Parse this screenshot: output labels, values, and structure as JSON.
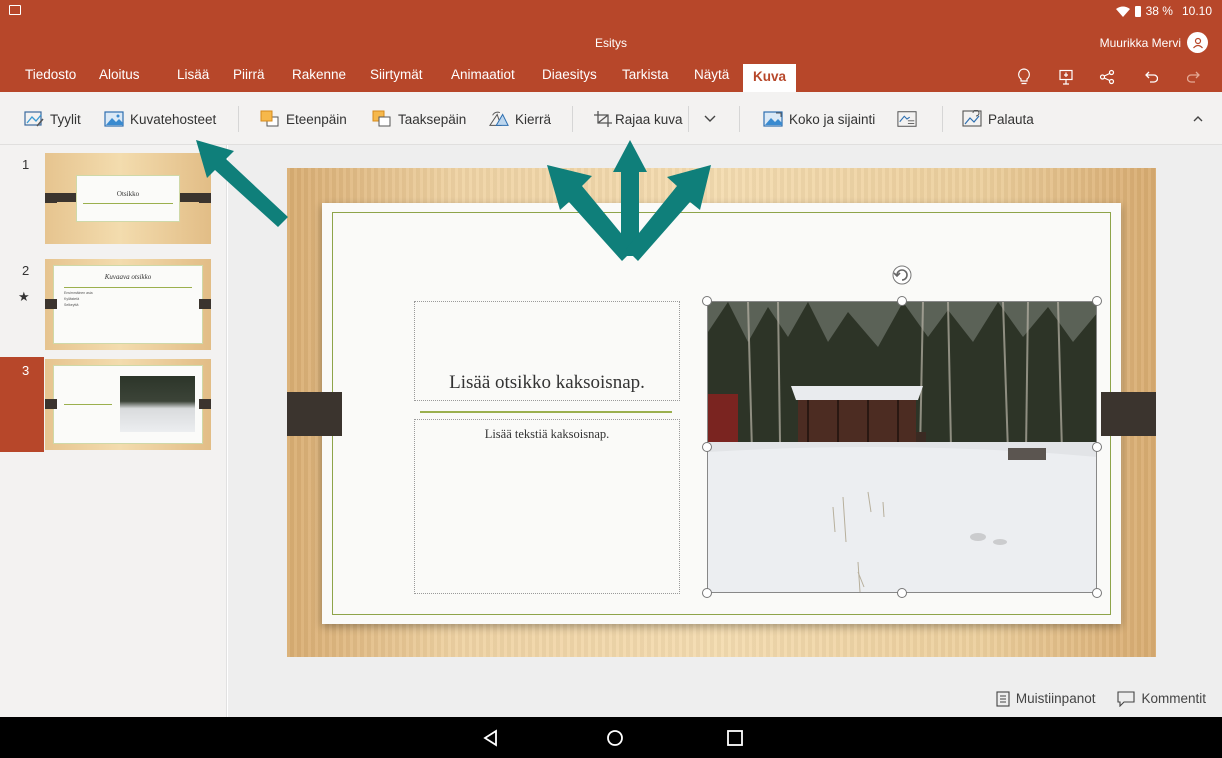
{
  "status_bar": {
    "battery": "38 %",
    "time": "10.10"
  },
  "app": {
    "title": "Esitys",
    "user_name": "Muurikka Mervi"
  },
  "menu": {
    "tabs": [
      {
        "label": "Tiedosto"
      },
      {
        "label": "Aloitus"
      },
      {
        "label": "Lisää"
      },
      {
        "label": "Piirrä"
      },
      {
        "label": "Rakenne"
      },
      {
        "label": "Siirtymät"
      },
      {
        "label": "Animaatiot"
      },
      {
        "label": "Diaesitys"
      },
      {
        "label": "Tarkista"
      },
      {
        "label": "Näytä"
      },
      {
        "label": "Kuva"
      }
    ],
    "active_tab": "Kuva",
    "right_icons": [
      "lightbulb-icon",
      "present-icon",
      "share-icon",
      "undo-icon",
      "redo-icon"
    ]
  },
  "ribbon": {
    "styles": "Tyylit",
    "picture_effects": "Kuvatehosteet",
    "bring_forward": "Eteenpäin",
    "send_backward": "Taaksepäin",
    "rotate": "Kierrä",
    "crop": "Rajaa kuva",
    "size_position": "Koko ja sijainti",
    "reset": "Palauta"
  },
  "slides": [
    {
      "number": "1",
      "title": "Otsikko"
    },
    {
      "number": "2",
      "title": "Kuvaava otsikko",
      "bullets": [
        "Ensimmäinen asia",
        "Kyllästetä",
        "Selkeyttä"
      ]
    },
    {
      "number": "3",
      "title": ""
    }
  ],
  "selected_slide": 3,
  "slide": {
    "title_placeholder": "Lisää otsikko kaksoisnap.",
    "body_placeholder": "Lisää tekstiä kaksoisnap."
  },
  "bottom": {
    "notes": "Muistiinpanot",
    "comments": "Kommentit"
  },
  "colors": {
    "accent": "#b7472a",
    "frame": "#8ea44a",
    "arrow": "#0f7f7a"
  }
}
